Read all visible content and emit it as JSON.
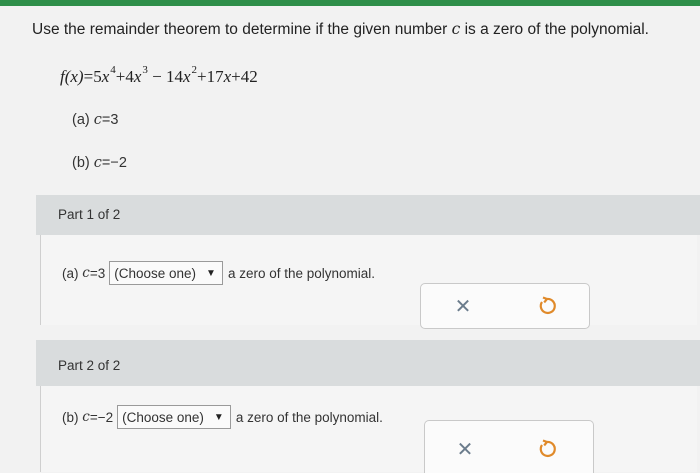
{
  "question": {
    "text_before": "Use the remainder theorem to determine if the given number ",
    "variable": "c",
    "text_after": " is a zero of the polynomial."
  },
  "polynomial": {
    "lhs": "f(x)",
    "equals": "=",
    "terms": [
      {
        "coef": "5",
        "var": "x",
        "exp": "4",
        "sign": ""
      },
      {
        "coef": "4",
        "var": "x",
        "exp": "3",
        "sign": "+"
      },
      {
        "coef": "14",
        "var": "x",
        "exp": "2",
        "sign": "−"
      },
      {
        "coef": "17",
        "var": "x",
        "exp": "",
        "sign": "+"
      },
      {
        "coef": "42",
        "var": "",
        "exp": "",
        "sign": "+"
      }
    ]
  },
  "sub_questions": {
    "a": {
      "label": "(a)",
      "var": "c",
      "value": "=3"
    },
    "b": {
      "label": "(b)",
      "var": "c",
      "value": "=−2"
    }
  },
  "parts": [
    {
      "header": "Part 1 of 2",
      "label": "(a)",
      "var": "c",
      "value": "=3",
      "select_value": "(Choose one)",
      "suffix": "a zero of the polynomial."
    },
    {
      "header": "Part 2 of 2",
      "label": "(b)",
      "var": "c",
      "value": "=−2",
      "select_value": "(Choose one)",
      "suffix": "a zero of the polynomial."
    }
  ],
  "icons": {
    "clear": "close-icon",
    "undo": "undo-icon",
    "dropdown": "triangle-down-icon"
  },
  "colors": {
    "top_bar": "#2f8f4a",
    "part_header_bg": "#d9dcdd",
    "clear_icon": "#6b7c8c",
    "undo_icon": "#e08a2a"
  }
}
